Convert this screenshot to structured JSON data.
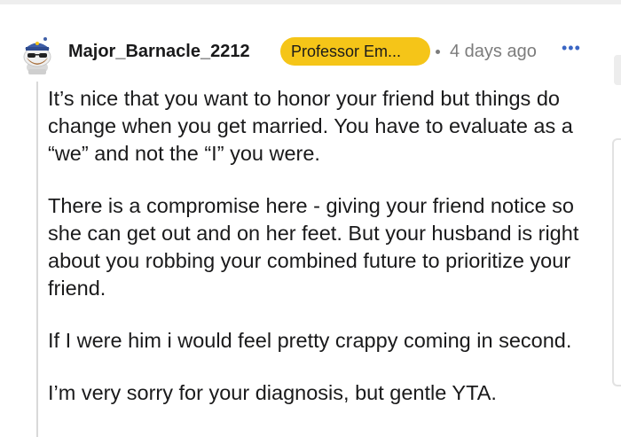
{
  "comment": {
    "author": "Major_Barnacle_2212",
    "flair": "Professor Em...",
    "timestamp": "4 days ago",
    "more_menu": "•••",
    "paragraphs": [
      "It’s nice that you want to honor your friend but things do change when you get married. You have to evaluate as a “we” and not the “I” you were.",
      "There is a compromise here - giving your friend notice so she can get out and on her feet. But your husband is right about you robbing your combined future to prioritize your friend.",
      "If I were him i would feel pretty crappy coming in second.",
      "I’m very sorry for your diagnosis, but gentle YTA."
    ]
  },
  "colors": {
    "flair_background": "#f5c518",
    "timestamp": "#7c7c7c",
    "menu_accent": "#3b66c4",
    "avatar_hat": "#3f5fa8"
  },
  "icons": {
    "avatar": "snoo-avatar-with-captain-hat-icon"
  }
}
